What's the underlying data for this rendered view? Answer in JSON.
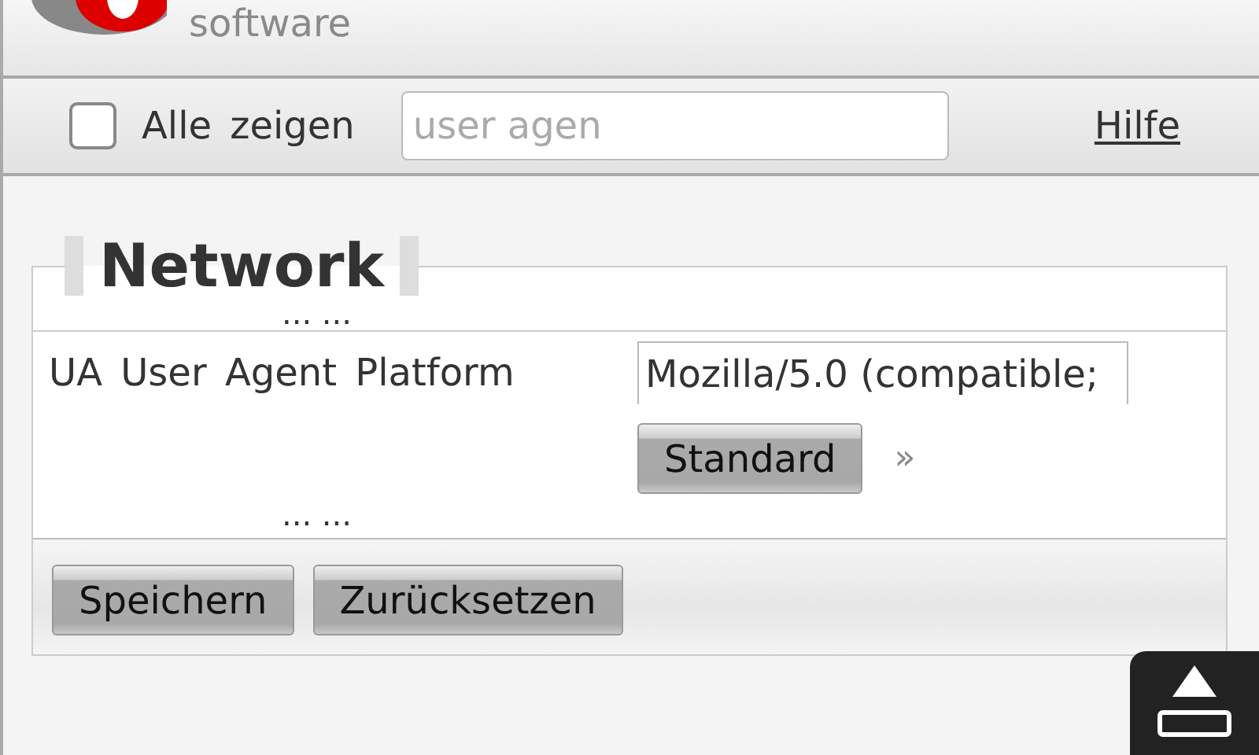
{
  "header": {
    "logo_text": "software"
  },
  "toolbar": {
    "show_all": {
      "label": "Alle zeigen",
      "checked": false
    },
    "search": {
      "value": "user agen"
    },
    "help_link": "Hilfe"
  },
  "section": {
    "title": "Network",
    "ellipsis_top": "... ...",
    "rows": [
      {
        "label": "UA User Agent Platform",
        "value": "Mozilla/5.0 (compatible;",
        "button": "Standard",
        "more": "»"
      }
    ],
    "ellipsis_bottom": "... ..."
  },
  "buttons": [
    "Speichern",
    "Zurücksetzen"
  ]
}
